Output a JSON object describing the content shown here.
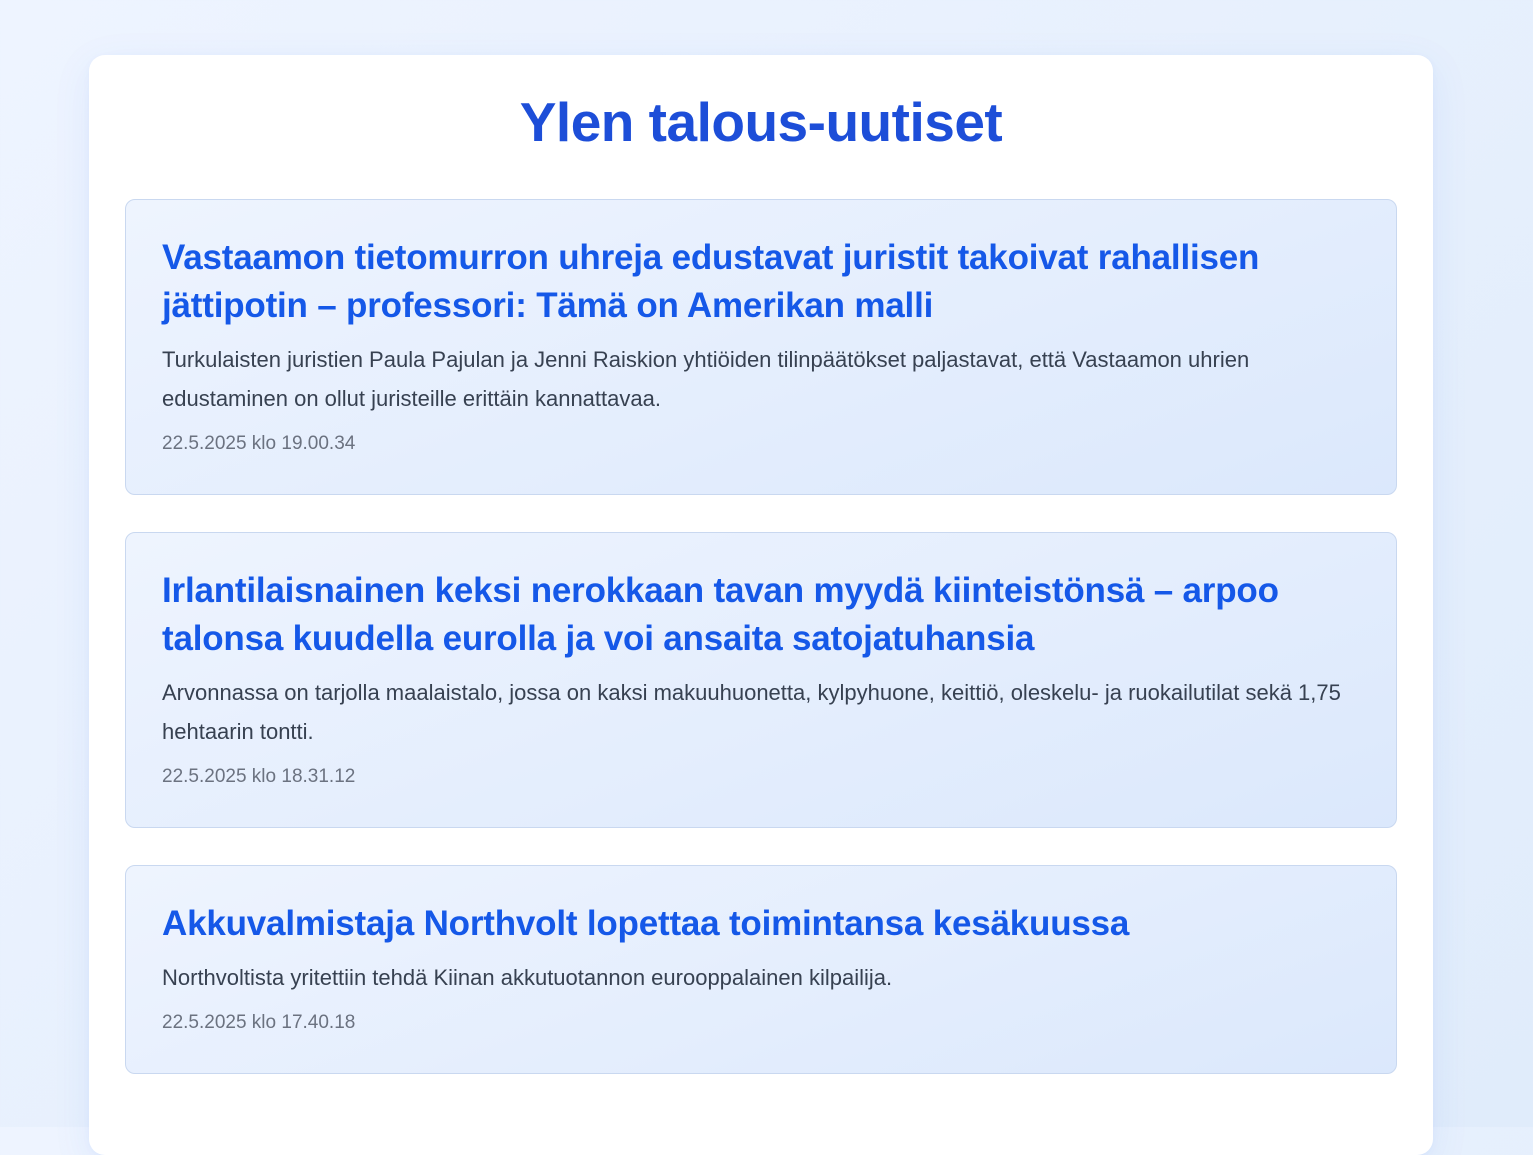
{
  "page": {
    "title": "Ylen talous-uutiset"
  },
  "articles": [
    {
      "title": "Vastaamon tietomurron uhreja edustavat juristit takoivat rahallisen jättipotin – professori: Tämä on Amerikan malli",
      "summary": "Turkulaisten juristien Paula Pajulan ja Jenni Raiskion yhtiöiden tilinpäätökset paljastavat, että Vastaamon uhrien edustaminen on ollut juristeille erittäin kannattavaa.",
      "date": "22.5.2025 klo 19.00.34"
    },
    {
      "title": "Irlantilaisnainen keksi nerokkaan tavan myydä kiinteistönsä – arpoo talonsa kuudella eurolla ja voi ansaita satojatuhansia",
      "summary": "Arvonnassa on tarjolla maalaistalo, jossa on kaksi makuuhuonetta, kylpyhuone, keittiö, oleskelu- ja ruokailutilat sekä 1,75 hehtaarin tontti.",
      "date": "22.5.2025 klo 18.31.12"
    },
    {
      "title": "Akkuvalmistaja Northvolt lopettaa toimintansa kesäkuussa",
      "summary": "Northvoltista yritettiin tehdä Kiinan akkutuotannon eurooppalainen kilpailija.",
      "date": "22.5.2025 klo 17.40.18"
    }
  ],
  "colors": {
    "title": "#1d4ed8",
    "article_title": "#1558e8",
    "summary": "#374151",
    "date": "#6b7280"
  }
}
